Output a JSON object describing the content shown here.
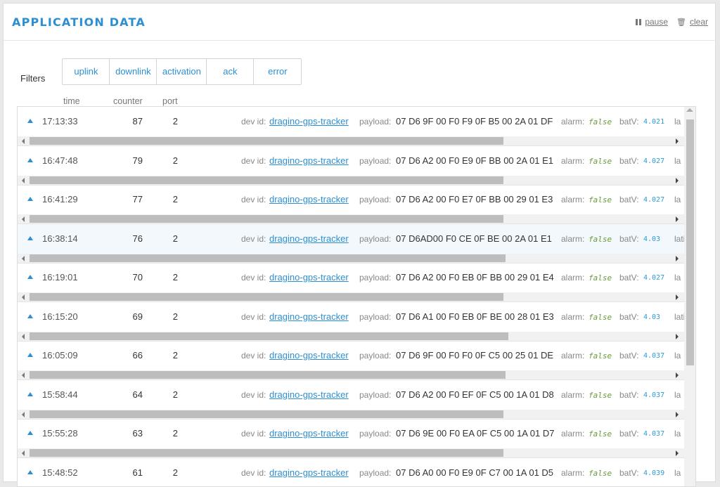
{
  "header": {
    "title": "APPLICATION DATA",
    "pause_label": "pause",
    "clear_label": "clear"
  },
  "filters": {
    "label": "Filters",
    "buttons": [
      "uplink",
      "downlink",
      "activation",
      "ack",
      "error"
    ]
  },
  "columns": {
    "time": "time",
    "counter": "counter",
    "port": "port"
  },
  "labels": {
    "dev_id": "dev id:",
    "payload": "payload:",
    "alarm": "alarm:",
    "batV": "batV:",
    "lat": "la",
    "lati": "lati"
  },
  "rows": [
    {
      "time": "17:13:33",
      "counter": "87",
      "port": "2",
      "dev_id": "dragino-gps-tracker",
      "payload": "07 D6 9F 00 F0 F9 0F B5 00 2A 01 DF",
      "alarm": "false",
      "batV": "4.021",
      "lat_label": "la",
      "selected": false
    },
    {
      "time": "16:47:48",
      "counter": "79",
      "port": "2",
      "dev_id": "dragino-gps-tracker",
      "payload": "07 D6 A2 00 F0 E9 0F BB 00 2A 01 E1",
      "alarm": "false",
      "batV": "4.027",
      "lat_label": "la",
      "selected": false
    },
    {
      "time": "16:41:29",
      "counter": "77",
      "port": "2",
      "dev_id": "dragino-gps-tracker",
      "payload": "07 D6 A2 00 F0 E7 0F BB 00 29 01 E3",
      "alarm": "false",
      "batV": "4.027",
      "lat_label": "la",
      "selected": false
    },
    {
      "time": "16:38:14",
      "counter": "76",
      "port": "2",
      "dev_id": "dragino-gps-tracker",
      "payload": "07 D6AD00 F0 CE 0F BE 00 2A 01 E1",
      "alarm": "false",
      "batV": "4.03",
      "lat_label": "lati",
      "selected": true
    },
    {
      "time": "16:19:01",
      "counter": "70",
      "port": "2",
      "dev_id": "dragino-gps-tracker",
      "payload": "07 D6 A2 00 F0 EB 0F BB 00 29 01 E4",
      "alarm": "false",
      "batV": "4.027",
      "lat_label": "la",
      "selected": false
    },
    {
      "time": "16:15:20",
      "counter": "69",
      "port": "2",
      "dev_id": "dragino-gps-tracker",
      "payload": "07 D6 A1 00 F0 EB 0F BE 00 28 01 E3",
      "alarm": "false",
      "batV": "4.03",
      "lat_label": "lati",
      "selected": false
    },
    {
      "time": "16:05:09",
      "counter": "66",
      "port": "2",
      "dev_id": "dragino-gps-tracker",
      "payload": "07 D6 9F 00 F0 F0 0F C5 00 25 01 DE",
      "alarm": "false",
      "batV": "4.037",
      "lat_label": "la",
      "selected": false
    },
    {
      "time": "15:58:44",
      "counter": "64",
      "port": "2",
      "dev_id": "dragino-gps-tracker",
      "payload": "07 D6 A2 00 F0 EF 0F C5 00 1A 01 D8",
      "alarm": "false",
      "batV": "4.037",
      "lat_label": "la",
      "selected": false
    },
    {
      "time": "15:55:28",
      "counter": "63",
      "port": "2",
      "dev_id": "dragino-gps-tracker",
      "payload": "07 D6 9E 00 F0 EA 0F C5 00 1A 01 D7",
      "alarm": "false",
      "batV": "4.037",
      "lat_label": "la",
      "selected": false
    },
    {
      "time": "15:48:52",
      "counter": "61",
      "port": "2",
      "dev_id": "dragino-gps-tracker",
      "payload": "07 D6 A0 00 F0 E9 0F C7 00 1A 01 D5",
      "alarm": "false",
      "batV": "4.039",
      "lat_label": "la",
      "selected": false
    }
  ]
}
